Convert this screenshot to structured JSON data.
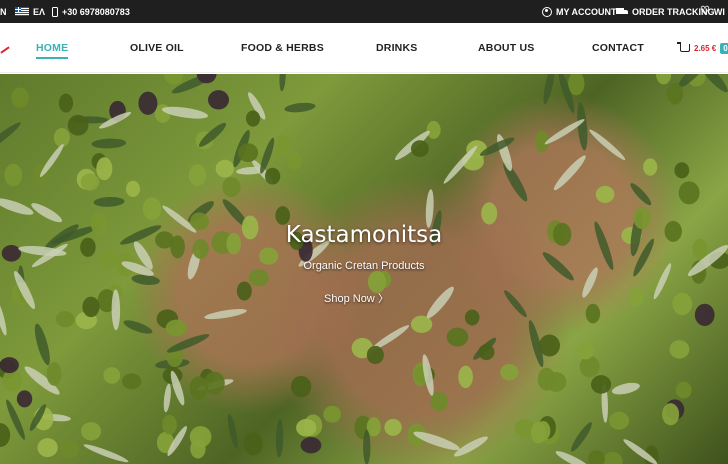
{
  "topbar": {
    "left_fragment": "N",
    "language": "ΕΛ",
    "phone": "+30 6978080783",
    "my_account": "MY ACCOUNT",
    "order_tracking": "ORDER TRACKING",
    "wishlist_fragment": "WI"
  },
  "nav": {
    "items": [
      {
        "label": "HOME",
        "active": true
      },
      {
        "label": "OLIVE OIL"
      },
      {
        "label": "FOOD & HERBS"
      },
      {
        "label": "DRINKS"
      },
      {
        "label": "ABOUT US"
      },
      {
        "label": "CONTACT"
      }
    ],
    "cart_total": "2.65 €",
    "cart_badge": "0"
  },
  "hero": {
    "title": "Kastamonitsa",
    "subtitle": "Organic Cretan Products",
    "cta": "Shop Now",
    "cta_icon": "chevron-right-icon"
  },
  "colors": {
    "accent": "#3bb1b6",
    "price": "#d9262f",
    "topbar_bg": "#1f1f1f"
  }
}
